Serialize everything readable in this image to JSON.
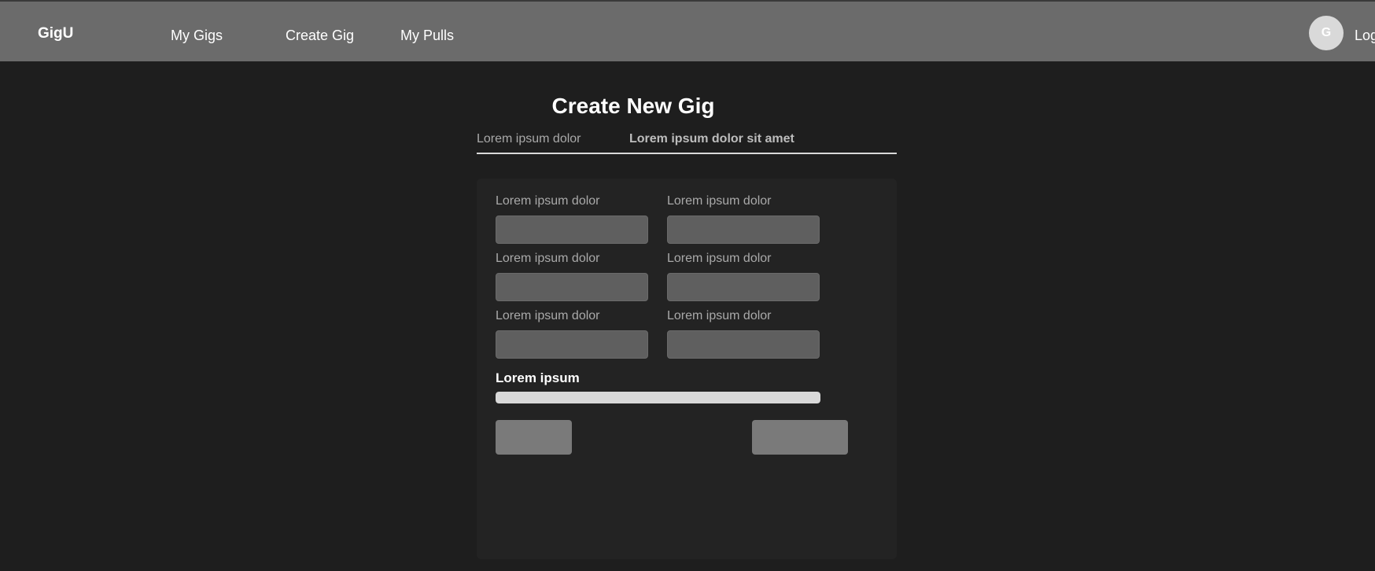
{
  "header": {
    "brand": "GigU",
    "nav": [
      "My Gigs",
      "Create Gig",
      "My Pulls"
    ],
    "avatar_initial": "G",
    "logout_label": "Log"
  },
  "page": {
    "title": "Create New Gig",
    "tabs": [
      {
        "label": "Lorem ipsum dolor",
        "active": false
      },
      {
        "label": "Lorem ipsum dolor sit amet",
        "active": true
      }
    ]
  },
  "form": {
    "fields": [
      {
        "label": "Lorem ipsum dolor",
        "value": "",
        "placeholder": ""
      },
      {
        "label": "Lorem ipsum dolor",
        "value": "",
        "placeholder": ""
      },
      {
        "label": "Lorem ipsum dolor",
        "value": "",
        "placeholder": ""
      },
      {
        "label": "Lorem ipsum dolor",
        "value": "",
        "placeholder": ""
      },
      {
        "label": "Lorem ipsum dolor",
        "value": "",
        "placeholder": ""
      },
      {
        "label": "Lorem ipsum dolor",
        "value": "",
        "placeholder": ""
      }
    ],
    "section_label": "Lorem ipsum",
    "progress": 1.0,
    "back_label": "",
    "next_label": ""
  },
  "colors": {
    "background": "#1e1e1e",
    "topbar": "#6b6b6b",
    "panel": "#232323",
    "input": "#5f5f5f",
    "button": "#7a7a7a",
    "progress": "#d9d9d9"
  }
}
